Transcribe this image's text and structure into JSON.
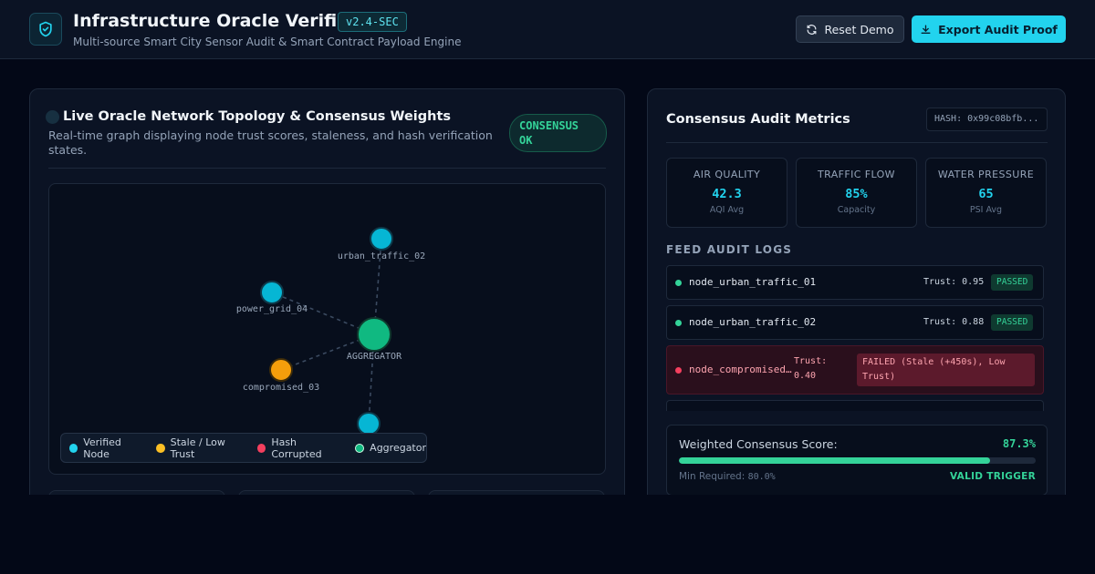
{
  "header": {
    "title": "Infrastructure Oracle Verifier",
    "version": "v2.4-SEC",
    "subtitle": "Multi-source Smart City Sensor Audit & Smart Contract Payload Engine",
    "reset_label": "Reset Demo",
    "export_label": "Export Audit Proof",
    "logo_icon": "shield-check-icon",
    "accent": "#22d3ee"
  },
  "topology": {
    "title": "Live Oracle Network Topology & Consensus Weights",
    "description": "Real-time graph displaying node trust scores, staleness, and hash verification states.",
    "badge": "CONSENSUS OK",
    "nodes": [
      {
        "id": "urban_traffic_02",
        "label": "urban_traffic_02",
        "status": "verified"
      },
      {
        "id": "power_grid_04",
        "label": "power_grid_04",
        "status": "verified"
      },
      {
        "id": "aggregator",
        "label": "AGGREGATOR",
        "status": "aggregator"
      },
      {
        "id": "compromised_03",
        "label": "compromised_03",
        "status": "stale"
      },
      {
        "id": "bottom",
        "label": "",
        "status": "verified"
      }
    ],
    "legend": [
      {
        "label": "Verified Node",
        "color": "#22d3ee"
      },
      {
        "label": "Stale / Low Trust",
        "color": "#fbbf24"
      },
      {
        "label": "Hash Corrupted",
        "color": "#f43f5e"
      },
      {
        "label": "Aggregator",
        "color": "#10b981"
      }
    ]
  },
  "metrics": {
    "title": "Consensus Audit Metrics",
    "hash": "HASH: 0x99c08bfb...",
    "cards": [
      {
        "label": "AIR QUALITY",
        "value": "42.3",
        "sub": "AQI Avg"
      },
      {
        "label": "TRAFFIC FLOW",
        "value": "85%",
        "sub": "Capacity"
      },
      {
        "label": "WATER PRESSURE",
        "value": "65",
        "sub": "PSI Avg"
      }
    ],
    "logs_heading": "FEED AUDIT LOGS",
    "logs": [
      {
        "name": "node_urban_traffic_01",
        "trust": "Trust: 0.95",
        "status": "PASSED"
      },
      {
        "name": "node_urban_traffic_02",
        "trust": "Trust: 0.88",
        "status": "PASSED"
      },
      {
        "name": "node_compromised…",
        "trust": "Trust: 0.40",
        "status": "FAILED (Stale (+450s), Low Trust)"
      }
    ],
    "score_label": "Weighted Consensus Score:",
    "score_value": "87.3%",
    "score_fraction": 0.873,
    "min_label": "Min Required:",
    "min_value": "80.0%",
    "trigger": "VALID TRIGGER"
  }
}
